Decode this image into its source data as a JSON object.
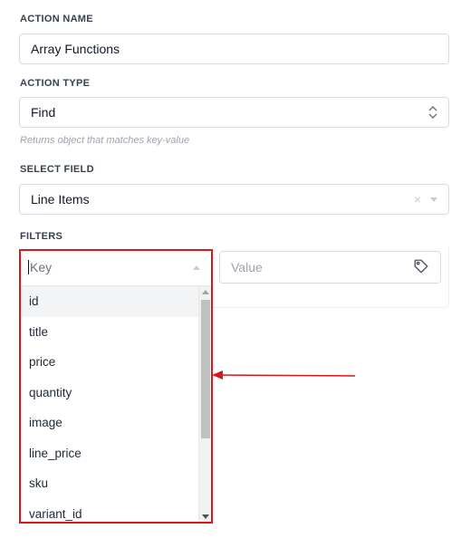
{
  "action_name": {
    "label": "ACTION NAME",
    "value": "Array Functions"
  },
  "action_type": {
    "label": "ACTION TYPE",
    "value": "Find",
    "helper": "Returns object that matches key-value"
  },
  "select_field": {
    "label": "SELECT FIELD",
    "value": "Line Items",
    "clear_icon": "×"
  },
  "filters": {
    "label": "FILTERS",
    "key_placeholder": "Key",
    "value_placeholder": "Value",
    "options": [
      "id",
      "title",
      "price",
      "quantity",
      "image",
      "line_price",
      "sku",
      "variant_id"
    ]
  },
  "colors": {
    "highlight_border": "#d9161c",
    "annotation_arrow": "#d9161c"
  },
  "icons": {
    "type_stepper": "up-down-chevrons-icon",
    "select_clear": "clear-x-icon",
    "select_caret": "caret-down-icon",
    "key_caret": "caret-up-icon",
    "value_tag": "tag-icon"
  }
}
